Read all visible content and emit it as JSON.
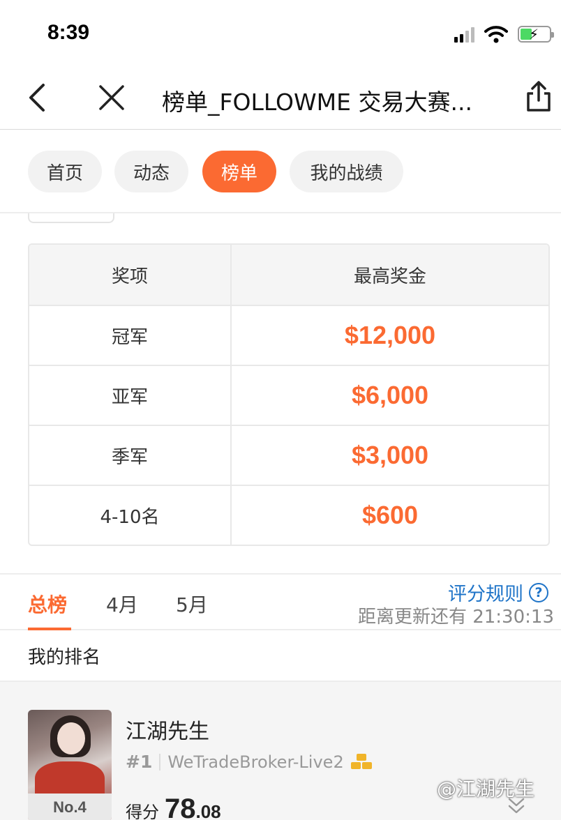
{
  "status_bar": {
    "time": "8:39",
    "icons": [
      "signal-icon",
      "wifi-icon",
      "battery-charging-icon"
    ]
  },
  "nav": {
    "title": "榜单_FOLLOWME 交易大赛...",
    "icons": [
      "back-icon",
      "close-icon",
      "share-icon"
    ]
  },
  "tabs": [
    {
      "label": "首页",
      "active": false
    },
    {
      "label": "动态",
      "active": false
    },
    {
      "label": "榜单",
      "active": true
    },
    {
      "label": "我的战绩",
      "active": false
    }
  ],
  "prize_table": {
    "headers": [
      "奖项",
      "最高奖金"
    ],
    "rows": [
      {
        "award": "冠军",
        "amount": "$12,000"
      },
      {
        "award": "亚军",
        "amount": "$6,000"
      },
      {
        "award": "季军",
        "amount": "$3,000"
      },
      {
        "award": "4-10名",
        "amount": "$600"
      }
    ]
  },
  "ranking": {
    "tabs": [
      {
        "label": "总榜",
        "active": true
      },
      {
        "label": "4月",
        "active": false
      },
      {
        "label": "5月",
        "active": false
      }
    ],
    "rules_label": "评分规则",
    "countdown": "距离更新还有 21:30:13"
  },
  "my_rank": {
    "label": "我的排名",
    "rank_badge": "No.4",
    "name": "江湖先生",
    "account_rank": "#1",
    "broker": "WeTradeBroker-Live2",
    "score_label": "得分",
    "score_int": "78",
    "score_dec": ".08"
  },
  "watermark": "@江湖先生",
  "colors": {
    "accent": "#fb6a32",
    "link": "#1f74c8"
  }
}
